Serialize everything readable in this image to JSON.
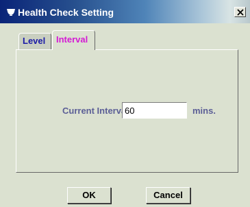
{
  "window": {
    "title": "Health Check Setting",
    "title_icon": "java-cup-icon",
    "close_label": "×"
  },
  "tabs": [
    {
      "label": "Level",
      "color": "#1a1aa6",
      "selected": false
    },
    {
      "label": "Interval",
      "color": "#d41ad4",
      "selected": true
    }
  ],
  "interval": {
    "label": "Current Interval:",
    "value": "60",
    "unit": "mins."
  },
  "buttons": {
    "ok": "OK",
    "cancel": "Cancel"
  },
  "colors": {
    "label_text": "#5b5e96",
    "panel_background": "#dbe1d0",
    "title_gradient_start": "#0a2478"
  }
}
